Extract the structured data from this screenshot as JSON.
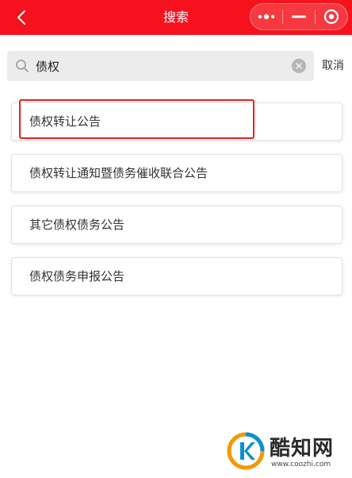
{
  "header": {
    "title": "搜索",
    "background_color": "#f5121d",
    "back_icon": "chevron-left-icon",
    "capsule": {
      "more_icon": "more-dots-icon",
      "minimize_icon": "minimize-icon",
      "close_icon": "target-close-icon"
    }
  },
  "search": {
    "icon": "search-icon",
    "value": "债权",
    "clear_icon": "clear-icon",
    "cancel_label": "取消"
  },
  "results": [
    {
      "label": "债权转让公告",
      "highlighted": true
    },
    {
      "label": "债权转让通知暨债务催收联合公告",
      "highlighted": false
    },
    {
      "label": "其它债权债务公告",
      "highlighted": false
    },
    {
      "label": "债权债务申报公告",
      "highlighted": false
    }
  ],
  "highlight_color": "#e8201f",
  "watermark": {
    "brand": "酷知网",
    "url": "www.coozhi.com",
    "logo_colors": [
      "#f39800",
      "#0a8fd6"
    ]
  }
}
